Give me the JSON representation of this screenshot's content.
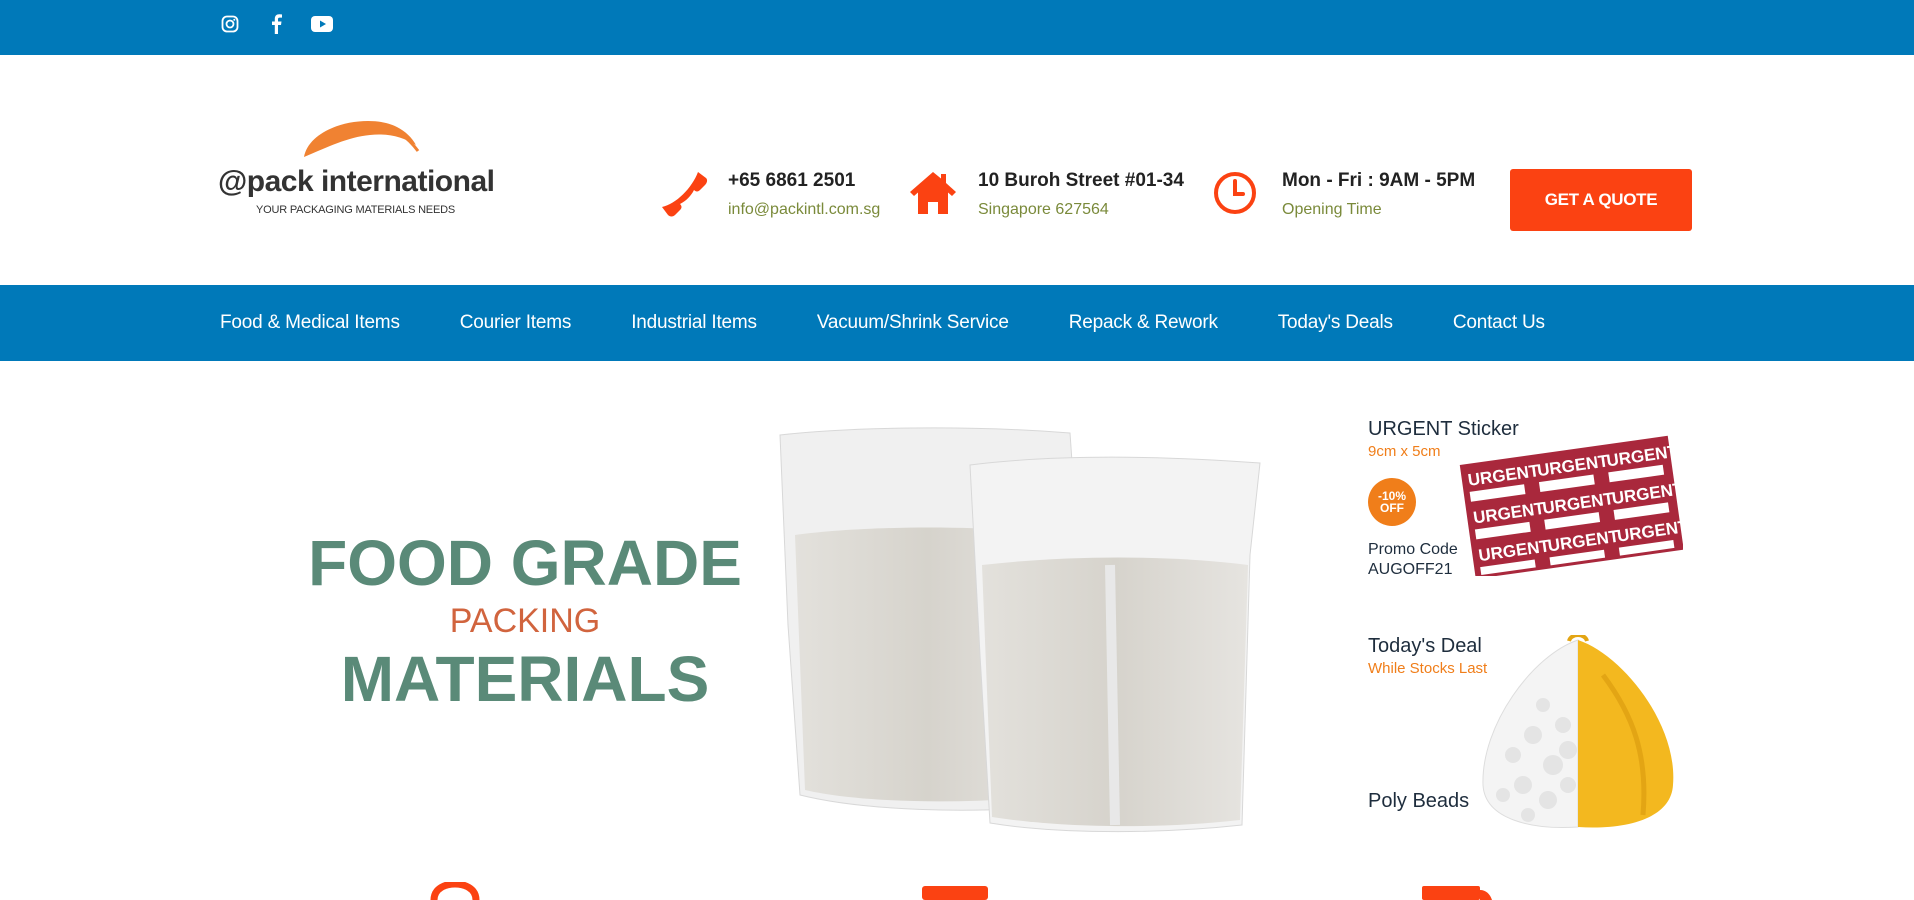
{
  "topbar": {
    "social": [
      {
        "icon": "instagram-icon"
      },
      {
        "icon": "facebook-icon"
      },
      {
        "icon": "youtube-icon"
      }
    ]
  },
  "header": {
    "logo": {
      "name": "@pack international",
      "tagline": "YOUR PACKAGING MATERIALS NEEDS"
    },
    "phone": {
      "icon": "phone-icon",
      "title": "+65 6861 2501",
      "subtitle": "info@packintl.com.sg"
    },
    "address": {
      "icon": "home-icon",
      "title": "10 Buroh Street #01-34",
      "subtitle": "Singapore 627564"
    },
    "hours": {
      "icon": "clock-icon",
      "title": "Mon - Fri : 9AM - 5PM",
      "subtitle": "Opening Time"
    },
    "cta": "GET A QUOTE"
  },
  "nav": {
    "items": [
      "Food & Medical Items",
      "Courier Items",
      "Industrial Items",
      "Vacuum/Shrink Service",
      "Repack & Rework",
      "Today's Deals",
      "Contact Us"
    ]
  },
  "hero": {
    "line1": "FOOD GRADE",
    "line2": "PACKING",
    "line3": "MATERIALS"
  },
  "promo_sticker": {
    "title": "URGENT Sticker",
    "size": "9cm x 5cm",
    "badge_top": "-10%",
    "badge_bottom": "OFF",
    "code_label": "Promo Code",
    "code": "AUGOFF21",
    "sticker_text": "URGENT"
  },
  "promo_deal": {
    "title": "Today's Deal",
    "subtitle": "While Stocks Last",
    "product": "Poly Beads"
  },
  "colors": {
    "primary": "#0079b9",
    "accent": "#fb4212",
    "hero_green": "#5a8a78",
    "hero_orange": "#d1643e",
    "promo_orange": "#f07e1a"
  }
}
